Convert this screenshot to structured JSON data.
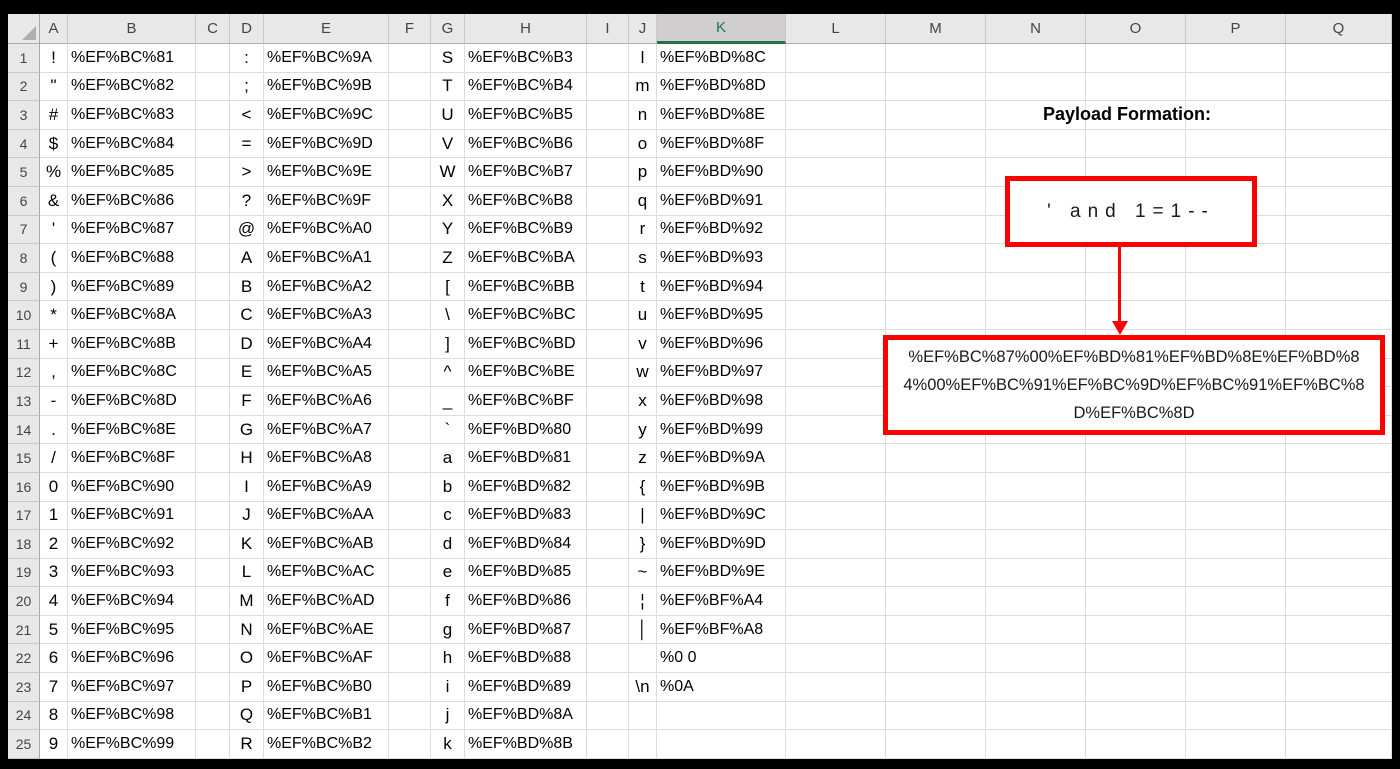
{
  "sheet": {
    "columns": [
      "A",
      "B",
      "C",
      "D",
      "E",
      "F",
      "G",
      "H",
      "I",
      "J",
      "K",
      "L",
      "M",
      "N",
      "O",
      "P",
      "Q"
    ],
    "selected_column": "K",
    "rows": [
      {
        "n": 1,
        "a": "!",
        "b": "%EF%BC%81",
        "d": ":",
        "e": "%EF%BC%9A",
        "g": "S",
        "h": "%EF%BC%B3",
        "j": "l",
        "k": "%EF%BD%8C"
      },
      {
        "n": 2,
        "a": "\"",
        "b": "%EF%BC%82",
        "d": ";",
        "e": "%EF%BC%9B",
        "g": "T",
        "h": "%EF%BC%B4",
        "j": "m",
        "k": "%EF%BD%8D"
      },
      {
        "n": 3,
        "a": "#",
        "b": "%EF%BC%83",
        "d": "<",
        "e": "%EF%BC%9C",
        "g": "U",
        "h": "%EF%BC%B5",
        "j": "n",
        "k": "%EF%BD%8E"
      },
      {
        "n": 4,
        "a": "$",
        "b": "%EF%BC%84",
        "d": "=",
        "e": "%EF%BC%9D",
        "g": "V",
        "h": "%EF%BC%B6",
        "j": "o",
        "k": "%EF%BD%8F"
      },
      {
        "n": 5,
        "a": "%",
        "b": "%EF%BC%85",
        "d": ">",
        "e": "%EF%BC%9E",
        "g": "W",
        "h": "%EF%BC%B7",
        "j": "p",
        "k": "%EF%BD%90"
      },
      {
        "n": 6,
        "a": "&",
        "b": "%EF%BC%86",
        "d": "?",
        "e": "%EF%BC%9F",
        "g": "X",
        "h": "%EF%BC%B8",
        "j": "q",
        "k": "%EF%BD%91"
      },
      {
        "n": 7,
        "a": "'",
        "b": "%EF%BC%87",
        "d": "@",
        "e": "%EF%BC%A0",
        "g": "Y",
        "h": "%EF%BC%B9",
        "j": "r",
        "k": "%EF%BD%92"
      },
      {
        "n": 8,
        "a": "(",
        "b": "%EF%BC%88",
        "d": "A",
        "e": "%EF%BC%A1",
        "g": "Z",
        "h": "%EF%BC%BA",
        "j": "s",
        "k": "%EF%BD%93"
      },
      {
        "n": 9,
        "a": ")",
        "b": "%EF%BC%89",
        "d": "B",
        "e": "%EF%BC%A2",
        "g": "[",
        "h": "%EF%BC%BB",
        "j": "t",
        "k": "%EF%BD%94"
      },
      {
        "n": 10,
        "a": "*",
        "b": "%EF%BC%8A",
        "d": "C",
        "e": "%EF%BC%A3",
        "g": "\\",
        "h": "%EF%BC%BC",
        "j": "u",
        "k": "%EF%BD%95"
      },
      {
        "n": 11,
        "a": "+",
        "b": "%EF%BC%8B",
        "d": "D",
        "e": "%EF%BC%A4",
        "g": "]",
        "h": "%EF%BC%BD",
        "j": "v",
        "k": "%EF%BD%96"
      },
      {
        "n": 12,
        "a": ",",
        "b": "%EF%BC%8C",
        "d": "E",
        "e": "%EF%BC%A5",
        "g": "^",
        "h": "%EF%BC%BE",
        "j": "w",
        "k": "%EF%BD%97"
      },
      {
        "n": 13,
        "a": "-",
        "b": "%EF%BC%8D",
        "d": "F",
        "e": "%EF%BC%A6",
        "g": "_",
        "h": "%EF%BC%BF",
        "j": "x",
        "k": "%EF%BD%98"
      },
      {
        "n": 14,
        "a": ".",
        "b": "%EF%BC%8E",
        "d": "G",
        "e": "%EF%BC%A7",
        "g": "`",
        "h": "%EF%BD%80",
        "j": "y",
        "k": "%EF%BD%99"
      },
      {
        "n": 15,
        "a": "/",
        "b": "%EF%BC%8F",
        "d": "H",
        "e": "%EF%BC%A8",
        "g": "a",
        "h": "%EF%BD%81",
        "j": "z",
        "k": "%EF%BD%9A"
      },
      {
        "n": 16,
        "a": "0",
        "b": "%EF%BC%90",
        "d": "I",
        "e": "%EF%BC%A9",
        "g": "b",
        "h": "%EF%BD%82",
        "j": "{",
        "k": "%EF%BD%9B"
      },
      {
        "n": 17,
        "a": "1",
        "b": "%EF%BC%91",
        "d": "J",
        "e": "%EF%BC%AA",
        "g": "c",
        "h": "%EF%BD%83",
        "j": "|",
        "k": "%EF%BD%9C"
      },
      {
        "n": 18,
        "a": "2",
        "b": "%EF%BC%92",
        "d": "K",
        "e": "%EF%BC%AB",
        "g": "d",
        "h": "%EF%BD%84",
        "j": "}",
        "k": "%EF%BD%9D"
      },
      {
        "n": 19,
        "a": "3",
        "b": "%EF%BC%93",
        "d": "L",
        "e": "%EF%BC%AC",
        "g": "e",
        "h": "%EF%BD%85",
        "j": "~",
        "k": "%EF%BD%9E"
      },
      {
        "n": 20,
        "a": "4",
        "b": "%EF%BC%94",
        "d": "M",
        "e": "%EF%BC%AD",
        "g": "f",
        "h": "%EF%BD%86",
        "j": "¦",
        "k": "%EF%BF%A4"
      },
      {
        "n": 21,
        "a": "5",
        "b": "%EF%BC%95",
        "d": "N",
        "e": "%EF%BC%AE",
        "g": "g",
        "h": "%EF%BD%87",
        "j": "│",
        "k": "%EF%BF%A8"
      },
      {
        "n": 22,
        "a": "6",
        "b": "%EF%BC%96",
        "d": "O",
        "e": "%EF%BC%AF",
        "g": "h",
        "h": "%EF%BD%88",
        "j": "",
        "k": "%0 0"
      },
      {
        "n": 23,
        "a": "7",
        "b": "%EF%BC%97",
        "d": "P",
        "e": "%EF%BC%B0",
        "g": "i",
        "h": "%EF%BD%89",
        "j": "\\n",
        "k": "%0A"
      },
      {
        "n": 24,
        "a": "8",
        "b": "%EF%BC%98",
        "d": "Q",
        "e": "%EF%BC%B1",
        "g": "j",
        "h": "%EF%BD%8A",
        "j": "",
        "k": ""
      },
      {
        "n": 25,
        "a": "9",
        "b": "%EF%BC%99",
        "d": "R",
        "e": "%EF%BC%B2",
        "g": "k",
        "h": "%EF%BD%8B",
        "j": "",
        "k": ""
      }
    ]
  },
  "annotation": {
    "title": "Payload Formation:",
    "source_text": "' and 1=1--",
    "encoded_payload": "%EF%BC%87%00%EF%BD%81%EF%BD%8E%EF%BD%84%00%EF%BC%91%EF%BC%9D%EF%BC%91%EF%BC%8D%EF%BC%8D"
  },
  "colors": {
    "annotation_box_border": "#FF0000",
    "selected_header_green": "#217346",
    "header_background": "#E8E8E8",
    "selected_header_background": "#D0CECE"
  }
}
